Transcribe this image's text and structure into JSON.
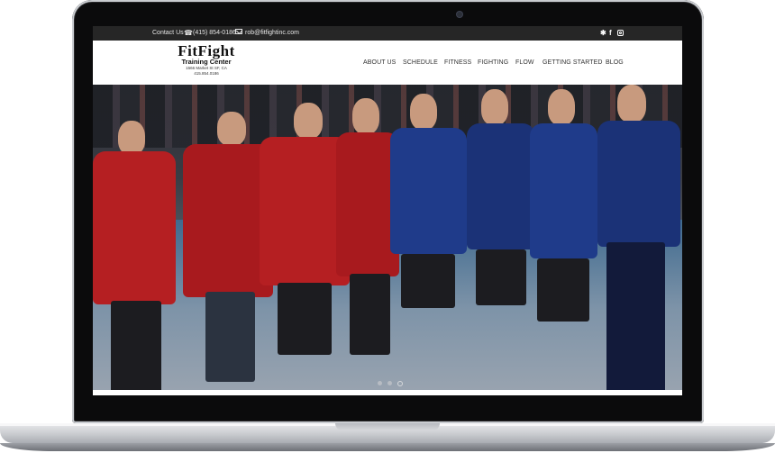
{
  "topbar": {
    "contact_label": "Contact Us",
    "phone": "(415) 854-0186",
    "email": "rob@fitfightinc.com",
    "social": [
      "yelp-icon",
      "facebook-icon",
      "instagram-icon"
    ]
  },
  "logo": {
    "name": "FitFight",
    "subtitle": "Training Center",
    "address": "1566 Market St SF, CA",
    "phone": "415.854.0186"
  },
  "nav": {
    "items": [
      "ABOUT US",
      "SCHEDULE",
      "FITNESS",
      "FIGHTING",
      "FLOW",
      "GETTING STARTED",
      "BLOG"
    ]
  },
  "slider": {
    "slide_count": 3,
    "active_index": 2
  },
  "colors": {
    "topbar_bg": "#262626",
    "gi_red": "#b51f22",
    "gi_blue": "#1f3b8a"
  }
}
